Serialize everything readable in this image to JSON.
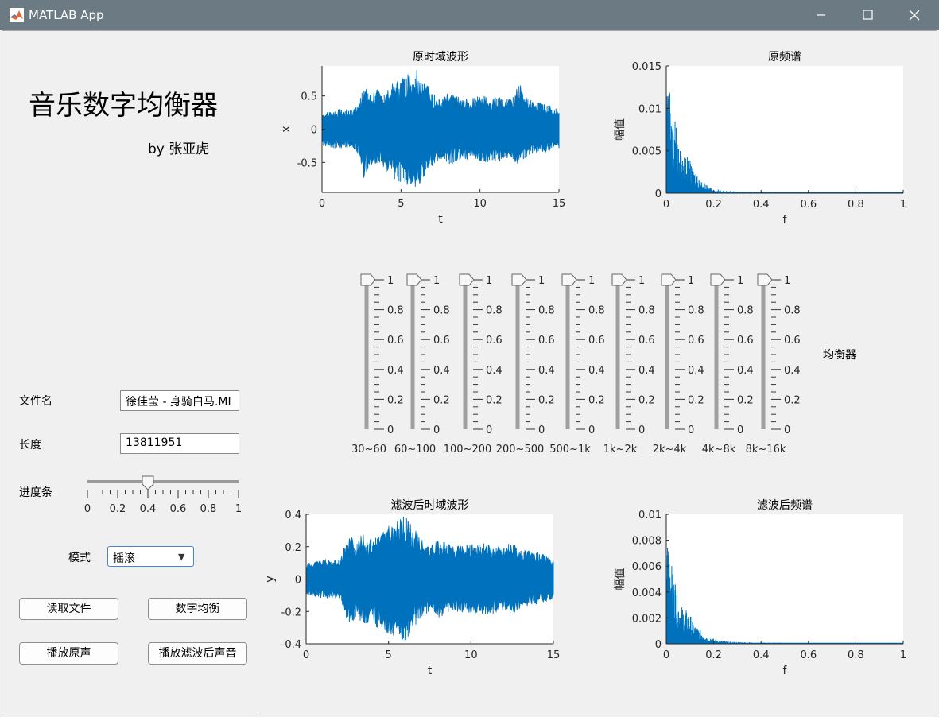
{
  "window": {
    "title": "MATLAB App"
  },
  "app": {
    "heading": "音乐数字均衡器",
    "author": "by 张亚虎"
  },
  "controls": {
    "filename_label": "文件名",
    "filename_value": "徐佳莹 - 身骑白马.MI",
    "length_label": "长度",
    "length_value": "13811951",
    "progress_label": "进度条",
    "progress_value": 0.4,
    "progress_ticks": [
      "0",
      "0.2",
      "0.4",
      "0.6",
      "0.8",
      "1"
    ],
    "mode_label": "模式",
    "mode_value": "摇滚",
    "read_button": "读取文件",
    "equalize_button": "数字均衡",
    "play_original_button": "播放原声",
    "play_filtered_button": "播放滤波后声音"
  },
  "equalizer": {
    "title": "均衡器",
    "ticks": [
      "0",
      "0.2",
      "0.4",
      "0.6",
      "0.8",
      "1"
    ],
    "bands": [
      {
        "label": "30~60",
        "value": 1
      },
      {
        "label": "60~100",
        "value": 1
      },
      {
        "label": "100~200",
        "value": 1
      },
      {
        "label": "200~500",
        "value": 1
      },
      {
        "label": "500~1k",
        "value": 1
      },
      {
        "label": "1k~2k",
        "value": 1
      },
      {
        "label": "2k~4k",
        "value": 1
      },
      {
        "label": "4k~8k",
        "value": 1
      },
      {
        "label": "8k~16k",
        "value": 1
      }
    ]
  },
  "colors": {
    "series": "#0072bd",
    "titlebar": "#6b7a83",
    "accent": "#3f87d6"
  },
  "chart_data": [
    {
      "type": "area",
      "title": "原时域波形",
      "xlabel": "t",
      "ylabel": "x",
      "xlim": [
        0,
        15
      ],
      "ylim": [
        -0.95,
        0.95
      ],
      "xticks": [
        "0",
        "5",
        "10",
        "15"
      ],
      "yticks": [
        "-0.5",
        "0",
        "0.5"
      ],
      "series": [
        {
          "x": [
            0,
            1,
            2,
            2.4,
            2.6,
            3,
            3.5,
            4,
            4.5,
            5,
            5.5,
            6,
            6.5,
            7,
            7.5,
            8,
            9,
            10,
            11,
            12,
            12.5,
            13,
            14,
            15
          ],
          "upper": [
            0.25,
            0.3,
            0.3,
            0.45,
            0.7,
            0.55,
            0.6,
            0.55,
            0.7,
            0.8,
            0.85,
            0.9,
            0.75,
            0.55,
            0.45,
            0.55,
            0.45,
            0.5,
            0.5,
            0.45,
            0.7,
            0.45,
            0.4,
            0.3
          ],
          "lower": [
            -0.25,
            -0.3,
            -0.3,
            -0.45,
            -0.75,
            -0.55,
            -0.55,
            -0.6,
            -0.75,
            -0.8,
            -0.85,
            -0.9,
            -0.7,
            -0.55,
            -0.45,
            -0.55,
            -0.45,
            -0.5,
            -0.5,
            -0.45,
            -0.6,
            -0.4,
            -0.35,
            -0.3
          ]
        }
      ]
    },
    {
      "type": "area",
      "title": "原频谱",
      "xlabel": "f",
      "ylabel": "幅值",
      "xlim": [
        0,
        1
      ],
      "ylim": [
        0,
        0.015
      ],
      "xticks": [
        "0",
        "0.2",
        "0.4",
        "0.6",
        "0.8",
        "1"
      ],
      "yticks": [
        "0",
        "0.005",
        "0.01",
        "0.015"
      ],
      "series": [
        {
          "x": [
            0,
            0.005,
            0.01,
            0.02,
            0.03,
            0.04,
            0.05,
            0.06,
            0.08,
            0.1,
            0.12,
            0.15,
            0.18,
            0.2,
            0.25,
            0.3,
            0.4,
            0.5,
            0.7,
            1
          ],
          "values": [
            0.005,
            0.0145,
            0.0135,
            0.011,
            0.0085,
            0.009,
            0.006,
            0.005,
            0.0045,
            0.004,
            0.0025,
            0.0015,
            0.0008,
            0.0005,
            0.0003,
            0.0002,
            0.00015,
            0.0001,
            0.0001,
            0.0001
          ]
        }
      ]
    },
    {
      "type": "area",
      "title": "滤波后时域波形",
      "xlabel": "t",
      "ylabel": "y",
      "xlim": [
        0,
        15
      ],
      "ylim": [
        -0.4,
        0.4
      ],
      "xticks": [
        "0",
        "5",
        "10",
        "15"
      ],
      "yticks": [
        "-0.4",
        "-0.2",
        "0",
        "0.2",
        "0.4"
      ],
      "series": [
        {
          "x": [
            0,
            1,
            2,
            2.3,
            2.6,
            3,
            3.5,
            4,
            4.5,
            5,
            5.5,
            6,
            6.5,
            7,
            7.5,
            8,
            9,
            10,
            11,
            12,
            12.5,
            13,
            14,
            15
          ],
          "upper": [
            0.1,
            0.12,
            0.12,
            0.2,
            0.28,
            0.25,
            0.28,
            0.25,
            0.3,
            0.33,
            0.36,
            0.4,
            0.32,
            0.25,
            0.2,
            0.25,
            0.2,
            0.22,
            0.22,
            0.2,
            0.24,
            0.18,
            0.17,
            0.12
          ],
          "lower": [
            -0.1,
            -0.12,
            -0.12,
            -0.2,
            -0.3,
            -0.25,
            -0.28,
            -0.28,
            -0.32,
            -0.34,
            -0.36,
            -0.4,
            -0.3,
            -0.25,
            -0.2,
            -0.24,
            -0.2,
            -0.22,
            -0.22,
            -0.2,
            -0.22,
            -0.18,
            -0.16,
            -0.12
          ]
        }
      ]
    },
    {
      "type": "area",
      "title": "滤波后频谱",
      "xlabel": "f",
      "ylabel": "幅值",
      "xlim": [
        0,
        1
      ],
      "ylim": [
        0,
        0.01
      ],
      "xticks": [
        "0",
        "0.2",
        "0.4",
        "0.6",
        "0.8",
        "1"
      ],
      "yticks": [
        "0",
        "0.002",
        "0.004",
        "0.006",
        "0.008",
        "0.01"
      ],
      "series": [
        {
          "x": [
            0,
            0.005,
            0.01,
            0.02,
            0.03,
            0.04,
            0.05,
            0.06,
            0.08,
            0.1,
            0.12,
            0.15,
            0.18,
            0.2,
            0.25,
            0.3,
            0.4,
            0.5,
            0.7,
            1
          ],
          "values": [
            0.003,
            0.0078,
            0.0075,
            0.0065,
            0.0052,
            0.005,
            0.0035,
            0.003,
            0.0027,
            0.0023,
            0.0015,
            0.001,
            0.0006,
            0.0004,
            0.0002,
            0.00015,
            0.0001,
            8e-05,
            6e-05,
            6e-05
          ]
        }
      ]
    }
  ]
}
